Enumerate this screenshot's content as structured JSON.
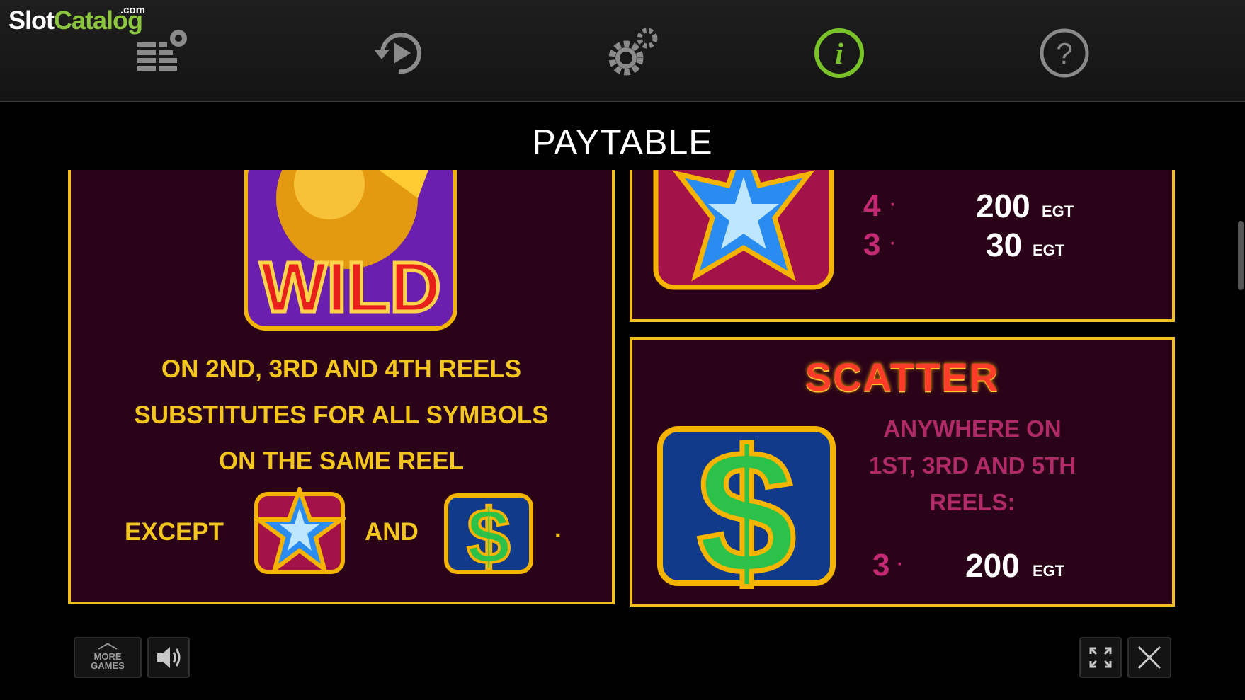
{
  "brand": {
    "name_part1": "Slot",
    "name_part2": "Catalog",
    "suffix": ".com"
  },
  "toolbar": {
    "icons": [
      "bet-settings-icon",
      "autoplay-icon",
      "settings-icon",
      "info-icon",
      "help-icon"
    ],
    "active": "info-icon",
    "active_color": "#7ac22a"
  },
  "page_title": "PAYTABLE",
  "wild_panel": {
    "symbol_label": "WILD",
    "line1": "ON 2ND, 3RD AND 4TH REELS",
    "line2": "SUBSTITUTES FOR ALL SYMBOLS",
    "line3": "ON THE SAME REEL",
    "except_label": "EXCEPT",
    "and_label": "AND",
    "period": "."
  },
  "star_panel": {
    "payouts": [
      {
        "count": "4",
        "amount": "200",
        "currency": "EGT"
      },
      {
        "count": "3",
        "amount": "30",
        "currency": "EGT"
      }
    ]
  },
  "scatter_panel": {
    "title": "SCATTER",
    "desc_line1": "ANYWHERE ON",
    "desc_line2": "1ST, 3RD AND 5TH",
    "desc_line3": "REELS:",
    "payouts": [
      {
        "count": "3",
        "amount": "200",
        "currency": "EGT"
      }
    ]
  },
  "bottom_bar": {
    "more_games_line1": "MORE",
    "more_games_line2": "GAMES"
  },
  "colors": {
    "panel_bg": "#2b0318",
    "panel_border": "#f2c01c",
    "gold_text": "#f2c61e",
    "pink_text": "#c42b74"
  }
}
